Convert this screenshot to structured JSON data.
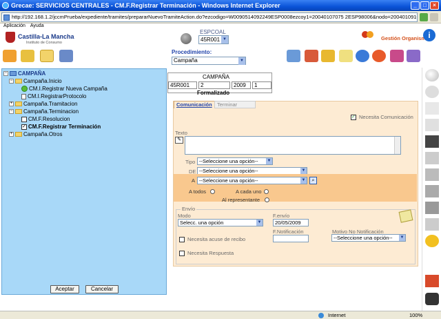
{
  "window": {
    "title": "Grecae: SERVICIOS CENTRALES - CM.F.Registrar Terminación - Windows Internet Explorer",
    "url": "http://192.168.1.2/jccmPrueba/expediente/tramites/prepararNuevoTramiteAction.do?ezcodigo=W0090514092249ESP0008ezcoy1=20040107075 2ESP98006&nodo=20040109102 2ESP84833#"
  },
  "menu": {
    "items": [
      "Aplicación",
      "Ayuda"
    ]
  },
  "header": {
    "logo_text": "Castilla-La Mancha",
    "logo_sub": "Instituto de Consumo",
    "espcoal_label": "ESPCOAL",
    "espcoal_value": "45R001",
    "gestion_label": "Gestión Organismo",
    "procedimiento_label": "Procedimiento:",
    "procedimiento_value": "Campaña"
  },
  "tree": {
    "root": "CAMPAÑA",
    "items": [
      "Campaña.Inicio",
      "CM.I.Registrar Nueva Campaña",
      "CM.I.RegistrarProtocolo",
      "Campaña.Tramitacion",
      "Campaña.Terminacion",
      "CM.F.Resolucion",
      "CM.F.Registrar Terminación",
      "Campaña.Otros"
    ],
    "accept_label": "Aceptar",
    "cancel_label": "Cancelar"
  },
  "campaign": {
    "header": "CAMPAÑA",
    "cells": [
      "45R001",
      "2",
      "2009",
      "1"
    ],
    "status": "Formalizado"
  },
  "tabs": [
    "Comunicación",
    "Terminar"
  ],
  "form": {
    "necesita_comunicacion": "Necesita Comunicación",
    "texto_label": "Texto",
    "tipo_label": "Tipo",
    "de_label": "DE",
    "a_label": "A",
    "seleccione": "--Seleccione una opción--",
    "a_todos": "A todos",
    "a_cada_uno": "A cada uno",
    "al_representante": "Al representante",
    "envio_label": "Envío",
    "modo_label": "Modo",
    "modo_value": "Selecc. una opción",
    "fenvio_label": "F.envío",
    "fenvio_value": "20/05/2009",
    "fnotificacion_label": "F.Notificación",
    "motivo_label": "Motivo No Notificación",
    "acuse_label": "Necesita acuse de recibo",
    "respuesta_label": "Necesita Respuesta"
  },
  "status": {
    "zone": "Internet",
    "zoom": "100%"
  }
}
